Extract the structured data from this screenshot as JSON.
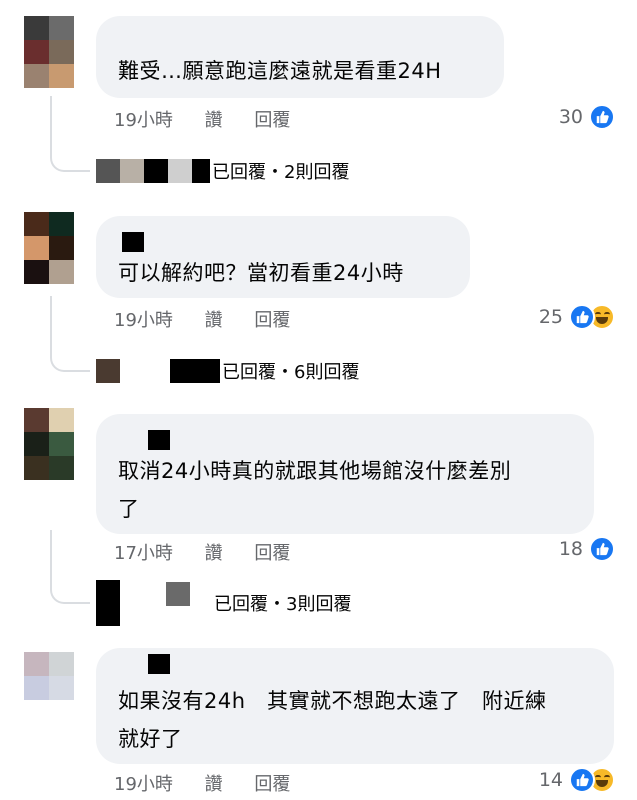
{
  "actions": {
    "like": "讚",
    "reply": "回覆"
  },
  "comments": [
    {
      "text": "難受…願意跑這麼遠就是看重24H",
      "time": "19小時",
      "reactions": {
        "count": "30",
        "types": [
          "like"
        ]
      },
      "replies": {
        "label": "已回覆・2則回覆"
      }
    },
    {
      "text": "可以解約吧？當初看重24小時",
      "time": "19小時",
      "reactions": {
        "count": "25",
        "types": [
          "like",
          "haha"
        ]
      },
      "replies": {
        "label": "已回覆・6則回覆"
      }
    },
    {
      "text": "取消24小時真的就跟其他場館沒什麼差別\n了",
      "time": "17小時",
      "reactions": {
        "count": "18",
        "types": [
          "like"
        ]
      },
      "replies": {
        "label": "已回覆・3則回覆"
      }
    },
    {
      "text": "如果沒有24h　其實就不想跑太遠了　附近練\n就好了",
      "time": "19小時",
      "reactions": {
        "count": "14",
        "types": [
          "like",
          "haha"
        ]
      }
    }
  ],
  "colors": {
    "bubble": "#f0f2f5",
    "meta": "#65676b",
    "like": "#1877f2",
    "haha": "#f7b928"
  }
}
